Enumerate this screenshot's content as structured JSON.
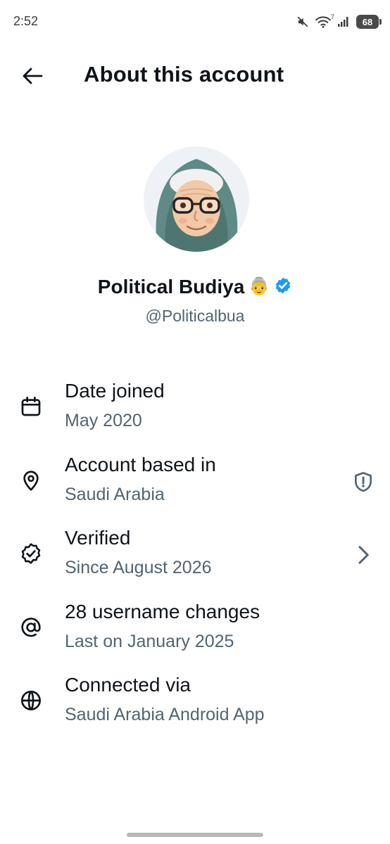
{
  "status_bar": {
    "time": "2:52",
    "wifi_badge": "7",
    "battery": "68"
  },
  "header": {
    "title": "About this account",
    "back_icon": "arrow-left-icon"
  },
  "profile": {
    "display_name": "Political Budiya",
    "name_emoji": "👵",
    "verified_icon": "verified-badge-icon",
    "verified_color": "#1d9bf0",
    "handle": "@Politicalbua"
  },
  "details": [
    {
      "icon": "calendar-icon",
      "title": "Date joined",
      "subtitle": "May 2020"
    },
    {
      "icon": "location-pin-icon",
      "title": "Account based in",
      "subtitle": "Saudi Arabia",
      "trailing": "shield-alert-icon"
    },
    {
      "icon": "verified-seal-icon",
      "title": "Verified",
      "subtitle": "Since August 2026",
      "trailing": "chevron-right-icon"
    },
    {
      "icon": "at-sign-icon",
      "title": "28 username changes",
      "subtitle": "Last on January 2025"
    },
    {
      "icon": "globe-icon",
      "title": "Connected via",
      "subtitle": "Saudi Arabia Android App"
    }
  ],
  "colors": {
    "text_primary": "#0f1419",
    "text_secondary": "#536471",
    "avatar_bg": "#eef2f7"
  }
}
